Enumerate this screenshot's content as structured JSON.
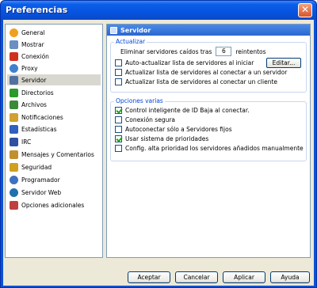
{
  "window": {
    "title": "Preferencias",
    "close_label": "✕"
  },
  "sidebar": {
    "items": [
      {
        "label": "General",
        "icon": "sun-icon",
        "color": "#f0a020"
      },
      {
        "label": "Mostrar",
        "icon": "monitor-icon",
        "color": "#6a8fc0"
      },
      {
        "label": "Conexión",
        "icon": "plug-icon",
        "color": "#d03020"
      },
      {
        "label": "Proxy",
        "icon": "globe-icon",
        "color": "#4080d0"
      },
      {
        "label": "Servidor",
        "icon": "server-icon",
        "color": "#5070a0"
      },
      {
        "label": "Directorios",
        "icon": "folder-icon",
        "color": "#2a9a2a"
      },
      {
        "label": "Archivos",
        "icon": "files-icon",
        "color": "#3a8a3a"
      },
      {
        "label": "Notificaciones",
        "icon": "bell-icon",
        "color": "#d0a030"
      },
      {
        "label": "Estadísticas",
        "icon": "chart-icon",
        "color": "#3060c0"
      },
      {
        "label": "IRC",
        "icon": "irc-icon",
        "color": "#3050a0"
      },
      {
        "label": "Mensajes y Comentarios",
        "icon": "messages-icon",
        "color": "#c09030"
      },
      {
        "label": "Seguridad",
        "icon": "lock-icon",
        "color": "#d0a020"
      },
      {
        "label": "Programador",
        "icon": "clock-icon",
        "color": "#4070c0"
      },
      {
        "label": "Servidor Web",
        "icon": "web-icon",
        "color": "#2070b0"
      },
      {
        "label": "Opciones adicionales",
        "icon": "options-icon",
        "color": "#c04040"
      }
    ],
    "selected_index": 4
  },
  "panel": {
    "title": "Servidor",
    "group_update": {
      "label": "Actualizar",
      "remove_prefix": "Eliminar servidores caídos tras",
      "remove_value": "6",
      "remove_suffix": "reintentos",
      "auto_update": "Auto-actualizar lista de servidores al iniciar",
      "edit_button": "Editar...",
      "update_on_server": "Actualizar lista de servidores al conectar a un servidor",
      "update_on_client": "Actualizar lista de servidores al conectar un cliente"
    },
    "group_misc": {
      "label": "Opciones varias",
      "options": [
        {
          "label": "Control inteligente de ID Baja al conectar.",
          "checked": true
        },
        {
          "label": "Conexión segura",
          "checked": false
        },
        {
          "label": "Autoconectar sólo a Servidores fijos",
          "checked": false
        },
        {
          "label": "Usar sistema de prioridades",
          "checked": true
        },
        {
          "label": "Config. alta prioridad los servidores añadidos manualmente",
          "checked": false
        }
      ]
    }
  },
  "buttons": {
    "ok": "Aceptar",
    "cancel": "Cancelar",
    "apply": "Aplicar",
    "help": "Ayuda"
  }
}
